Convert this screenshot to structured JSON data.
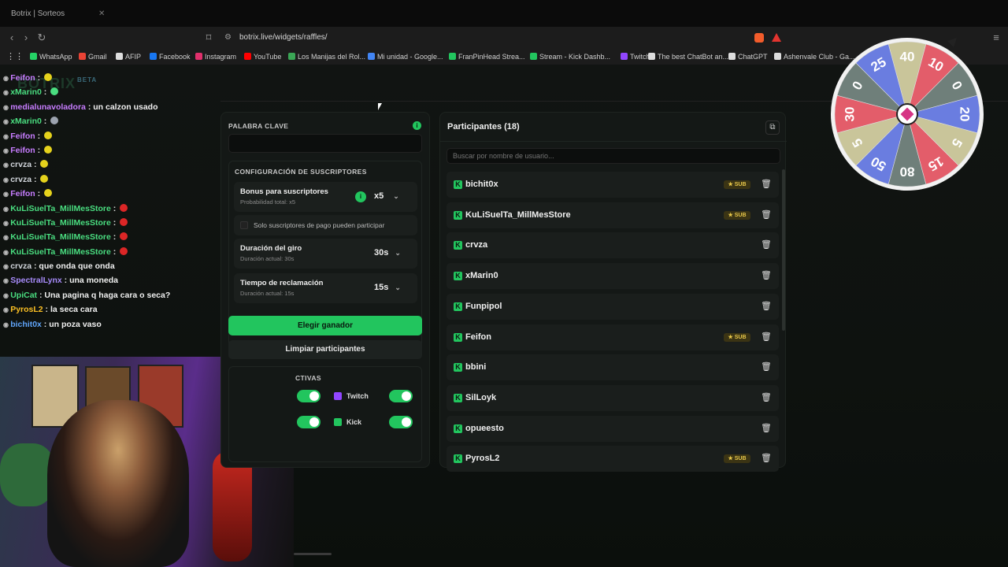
{
  "browser": {
    "tab_title": "Botrix | Sorteos",
    "url": "botrix.live/widgets/raffles/",
    "bookmarks": [
      "WhatsApp",
      "Gmail",
      "AFIP",
      "Facebook",
      "Instagram",
      "YouTube",
      "Los Manijas del Rol...",
      "Mi unidad - Google...",
      "FranPinHead Strea...",
      "Stream - Kick Dashb...",
      "Twitch",
      "The best ChatBot an...",
      "ChatGPT",
      "Ashenvale Club - Ga..."
    ],
    "bookmark_colors": [
      "#25d366",
      "#ea4335",
      "#dddddd",
      "#1877f2",
      "#e1306c",
      "#ff0000",
      "#3aa655",
      "#4285f4",
      "#22c55e",
      "#22c55e",
      "#9146ff",
      "#dddddd",
      "#dddddd",
      "#dddddd"
    ]
  },
  "logo": {
    "text": "BOTRIX",
    "badge": "BETA"
  },
  "chat": [
    {
      "user": "Feifon",
      "color": "#c77dff",
      "msg": "",
      "emote": "#e5d21c"
    },
    {
      "user": "xMarin0",
      "color": "#4ade80",
      "msg": "",
      "emote": "#4ade80"
    },
    {
      "user": "medialunavoladora",
      "color": "#c77dff",
      "msg": "un calzon usado",
      "emote": ""
    },
    {
      "user": "xMarin0",
      "color": "#4ade80",
      "msg": "",
      "emote": "#9ca3af"
    },
    {
      "user": "Feifon",
      "color": "#c77dff",
      "msg": "",
      "emote": "#e5d21c"
    },
    {
      "user": "Feifon",
      "color": "#c77dff",
      "msg": "",
      "emote": "#e5d21c"
    },
    {
      "user": "crvza",
      "color": "#d1d5db",
      "msg": "",
      "emote": "#e5d21c"
    },
    {
      "user": "crvza",
      "color": "#d1d5db",
      "msg": "",
      "emote": "#e5d21c"
    },
    {
      "user": "Feifon",
      "color": "#c77dff",
      "msg": "",
      "emote": "#e5d21c"
    },
    {
      "user": "KuLiSuelTa_MillMesStore",
      "color": "#4ade80",
      "msg": "",
      "emote": "#dc2626"
    },
    {
      "user": "KuLiSuelTa_MillMesStore",
      "color": "#4ade80",
      "msg": "",
      "emote": "#dc2626"
    },
    {
      "user": "KuLiSuelTa_MillMesStore",
      "color": "#4ade80",
      "msg": "",
      "emote": "#dc2626"
    },
    {
      "user": "KuLiSuelTa_MillMesStore",
      "color": "#4ade80",
      "msg": "",
      "emote": "#dc2626"
    },
    {
      "user": "crvza",
      "color": "#d1d5db",
      "msg": "que onda que onda",
      "emote": ""
    },
    {
      "user": "SpectralLynx",
      "color": "#a78bfa",
      "msg": "una moneda",
      "emote": ""
    },
    {
      "user": "UpiCat",
      "color": "#4ade80",
      "msg": "Una pagina q haga cara o seca?",
      "emote": ""
    },
    {
      "user": "PyrosL2",
      "color": "#fbbf24",
      "msg": "la seca cara",
      "emote": ""
    },
    {
      "user": "bichit0x",
      "color": "#60a5fa",
      "msg": "un poza vaso",
      "emote": ""
    }
  ],
  "config": {
    "keyword_label": "PALABRA CLAVE",
    "keyword_value": "",
    "subs_section": "CONFIGURACIÓN DE SUSCRIPTORES",
    "bonus_title": "Bonus para suscriptores",
    "bonus_sub": "Probabilidad total: x5",
    "bonus_value": "x5",
    "only_paid": "Solo suscriptores de pago pueden participar",
    "spin_title": "Duración del giro",
    "spin_sub": "Duración actual: 30s",
    "spin_value": "30s",
    "claim_title": "Tiempo de reclamación",
    "claim_sub": "Duración actual: 15s",
    "claim_value": "15s",
    "pick_winner": "Elegir ganador",
    "clear": "Limpiar participantes",
    "platforms_label": "CTIVAS",
    "twitch": "Twitch",
    "kick": "Kick"
  },
  "participants": {
    "title": "Participantes (18)",
    "search_placeholder": "Buscar por nombre de usuario...",
    "sub_badge": "SUB",
    "rows": [
      {
        "name": "bichit0x",
        "sub": true
      },
      {
        "name": "KuLiSuelTa_MillMesStore",
        "sub": true
      },
      {
        "name": "crvza",
        "sub": false
      },
      {
        "name": "xMarin0",
        "sub": false
      },
      {
        "name": "Funpipol",
        "sub": false
      },
      {
        "name": "Feifon",
        "sub": true
      },
      {
        "name": "bbini",
        "sub": false
      },
      {
        "name": "SilLoyk",
        "sub": false
      },
      {
        "name": "opueesto",
        "sub": false
      },
      {
        "name": "PyrosL2",
        "sub": true
      }
    ]
  },
  "wheel": {
    "segments": [
      "40",
      "10",
      "0",
      "20",
      "5",
      "15",
      "80",
      "50",
      "5",
      "30",
      "0",
      "25"
    ],
    "colors": [
      "#c9c59a",
      "#e35d6a",
      "#6f7f7a",
      "#6a7de0",
      "#c9c59a",
      "#e35d6a",
      "#6f7f7a",
      "#6a7de0",
      "#c9c59a",
      "#e35d6a",
      "#6f7f7a",
      "#6a7de0"
    ]
  }
}
